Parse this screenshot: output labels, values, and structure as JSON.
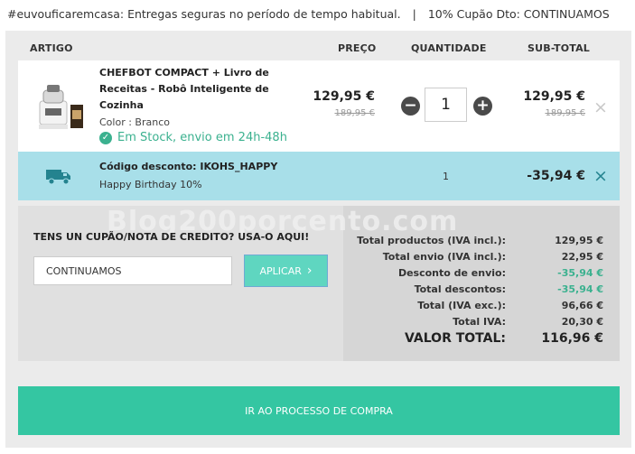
{
  "banner": {
    "left": "#euvouficaremcasa: Entregas seguras no período de tempo habitual.",
    "separator": "|",
    "right": "10% Cupão Dto: CONTINUAMOS"
  },
  "table_headers": {
    "artigo": "ARTIGO",
    "preco": "PREÇO",
    "quantidade": "QUANTIDADE",
    "subtotal": "SUB-TOTAL"
  },
  "product": {
    "name": "CHEFBOT COMPACT + Livro de Receitas - Robô Inteligente de Cozinha",
    "color": "Color : Branco",
    "stock": "Em Stock, envio em 24h-48h",
    "price": "129,95 €",
    "old_price": "189,95 €",
    "quantity": "1",
    "subtotal": "129,95 €",
    "old_subtotal": "189,95 €",
    "minus": "−",
    "plus": "+",
    "remove": "×"
  },
  "discount": {
    "code": "Código desconto: IKOHS_HAPPY",
    "description": "Happy Birthday 10%",
    "quantity": "1",
    "value": "-35,94 €",
    "remove": "×"
  },
  "watermark": "Blog200porcento.com",
  "coupon": {
    "label": "TENS UN CUPÃO/NOTA DE CREDITO? USA-O AQUI!",
    "value": "CONTINUAMOS",
    "apply_label": "APLICAR",
    "apply_arrow": "›"
  },
  "totals": [
    {
      "label": "Total productos (IVA incl.):",
      "value": "129,95 €"
    },
    {
      "label": "Total envio (IVA incl.):",
      "value": "22,95 €"
    },
    {
      "label": "Desconto de envio:",
      "value": "-35,94 €"
    },
    {
      "label": "Total descontos:",
      "value": "-35,94 €"
    },
    {
      "label": "Total (IVA exc.):",
      "value": "96,66 €"
    },
    {
      "label": "Total IVA:",
      "value": "20,30 €"
    },
    {
      "label": "VALOR TOTAL:",
      "value": "116,96 €"
    }
  ],
  "checkout_label": "IR AO PROCESSO DE COMPRA",
  "colors": {
    "accent": "#34c6a2",
    "discount_row": "#a8dfe9",
    "stock_green": "#3bb18f",
    "panel": "#ebebeb"
  }
}
